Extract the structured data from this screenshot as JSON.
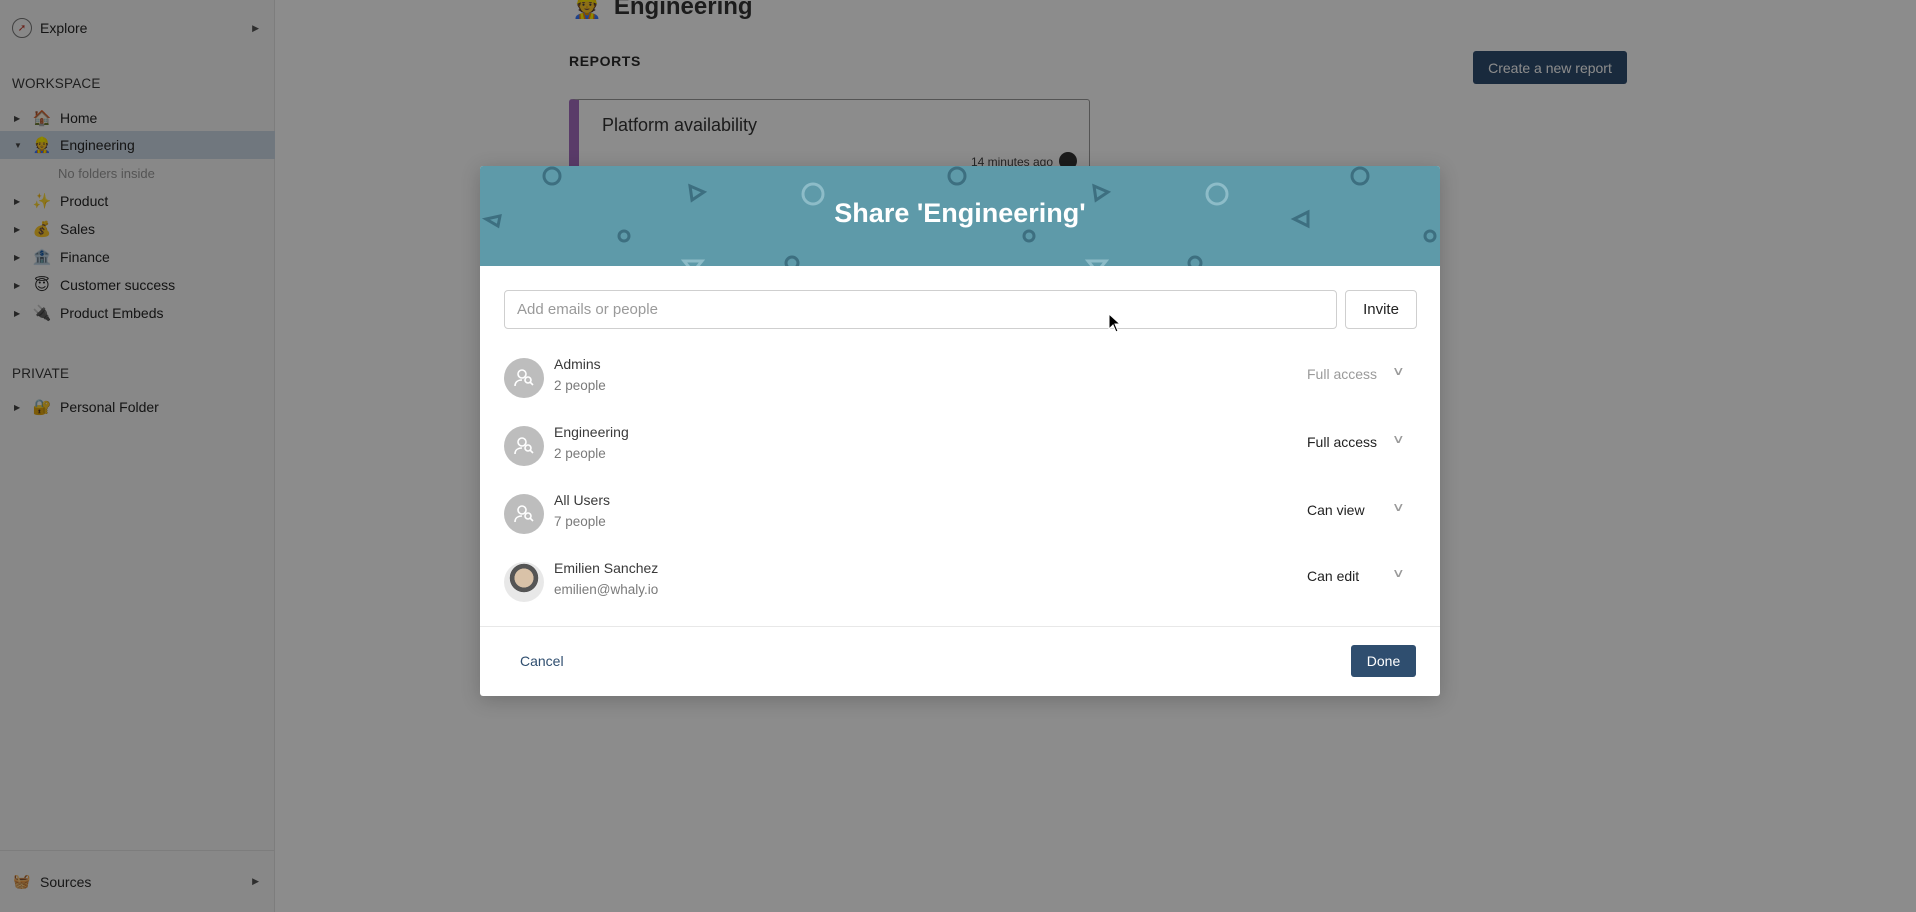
{
  "sidebar": {
    "explore_label": "Explore",
    "workspace_heading": "WORKSPACE",
    "items": [
      {
        "label": "Home",
        "emoji": "🏠"
      },
      {
        "label": "Engineering",
        "emoji": "👷"
      },
      {
        "label": "Product",
        "emoji": "✨"
      },
      {
        "label": "Sales",
        "emoji": "💰"
      },
      {
        "label": "Finance",
        "emoji": "🏦"
      },
      {
        "label": "Customer success",
        "emoji": "😇"
      },
      {
        "label": "Product Embeds",
        "emoji": "🔌"
      }
    ],
    "empty_folder_text": "No folders inside",
    "private_heading": "PRIVATE",
    "private_items": [
      {
        "label": "Personal Folder",
        "emoji": "🔐"
      }
    ],
    "sources_label": "Sources",
    "sources_emoji": "🧺"
  },
  "main": {
    "title": "Engineering",
    "title_emoji": "👷",
    "reports_label": "REPORTS",
    "create_button": "Create a new report",
    "report_card": {
      "title": "Platform availability",
      "time": "14 minutes ago",
      "accent_color": "#a56cc0"
    }
  },
  "modal": {
    "title": "Share 'Engineering'",
    "header_color": "#5e9aa9",
    "input_placeholder": "Add emails or people",
    "invite_button": "Invite",
    "members": [
      {
        "name": "Admins",
        "sub": "2 people",
        "role": "Full access",
        "type": "group",
        "muted": true
      },
      {
        "name": "Engineering",
        "sub": "2 people",
        "role": "Full access",
        "type": "group",
        "muted": false
      },
      {
        "name": "All Users",
        "sub": "7 people",
        "role": "Can view",
        "type": "group",
        "muted": false
      },
      {
        "name": "Emilien Sanchez",
        "sub": "emilien@whaly.io",
        "role": "Can edit",
        "type": "user",
        "muted": false
      }
    ],
    "cancel_button": "Cancel",
    "done_button": "Done",
    "primary_color": "#2f4e6f"
  }
}
